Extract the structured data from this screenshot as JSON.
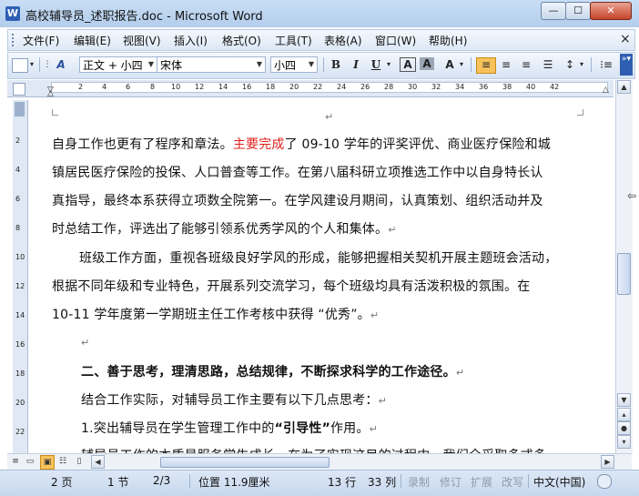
{
  "window": {
    "title": "高校辅导员_述职报告.doc - Microsoft Word",
    "app_icon_glyph": "W",
    "minimize_glyph": "—",
    "maximize_glyph": "☐",
    "close_glyph": "✕"
  },
  "menu": {
    "items": [
      "文件(F)",
      "编辑(E)",
      "视图(V)",
      "插入(I)",
      "格式(O)",
      "工具(T)",
      "表格(A)",
      "窗口(W)",
      "帮助(H)"
    ],
    "close_doc": "×"
  },
  "toolbar": {
    "style": "正文 + 小四",
    "font": "宋体",
    "size": "小四",
    "bold": "B",
    "italic": "I",
    "underline": "U",
    "style_icon": "A",
    "char_border": "A",
    "char_shade": "A",
    "highlight": "A"
  },
  "ruler": {
    "numbers": [
      "2",
      "4",
      "6",
      "8",
      "10",
      "12",
      "14",
      "16",
      "18",
      "20",
      "22",
      "24",
      "26",
      "28",
      "30",
      "32",
      "34",
      "36",
      "38",
      "40",
      "42"
    ],
    "vertical_numbers": [
      "2",
      "4",
      "6",
      "8",
      "10",
      "12",
      "14",
      "16",
      "18",
      "20",
      "22"
    ]
  },
  "document": {
    "para_mark": "↵",
    "line1a": "自身工作也更有了程序和章法。",
    "line1b": "主要完成",
    "line1c": "了 09-10 学年的评奖评优、商业医疗保险和城",
    "line2": "镇居民医疗保险的投保、人口普查等工作。在第八届科研立项推选工作中以自身特长认",
    "line3": "真指导，最终本系获得立项数全院第一。在学风建设月期间，认真策划、组织活动并及",
    "line4": "时总结工作，评选出了能够引领系优秀学风的个人和集体。",
    "line5": "班级工作方面，重视各班级良好学风的形成，能够把握相关契机开展主题班会活动，",
    "line6": "根据不同年级和专业特色，开展系列交流学习，每个班级均具有活泼积极的氛围。在",
    "line7": "10-11 学年度第一学期班主任工作考核中获得 “优秀”。",
    "heading2": "二、善于思考，理清思路，总结规律，不断探求科学的工作途径。",
    "line9": "结合工作实际，对辅导员工作主要有以下几点思考：",
    "line10a": "1.突出辅导员在学生管理工作中的",
    "line10b": "“引导性”",
    "line10c": "作用。",
    "line11": "辅导员工作的本质是服务学生成长，在为了实现这目的过程中，我们全采取多式多"
  },
  "status": {
    "page": "2 页",
    "section": "1 节",
    "page_of": "2/3",
    "position": "位置 11.9厘米",
    "row": "13 行",
    "col": "33 列",
    "rec": "录制",
    "rev": "修订",
    "ext": "扩展",
    "ovr": "改写",
    "lang": "中文(中国)"
  }
}
